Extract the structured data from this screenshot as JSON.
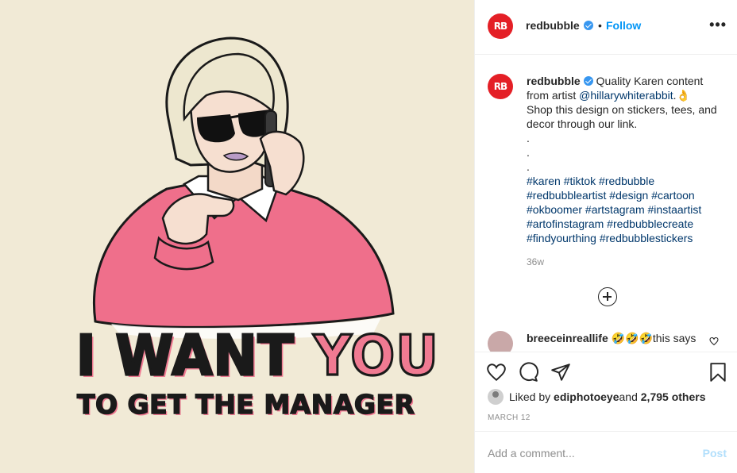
{
  "post_image": {
    "headline_part1": "I WANT",
    "headline_part2": "YOU",
    "subline": "TO GET THE MANAGER"
  },
  "header": {
    "avatar_text": "RB",
    "username": "redbubble",
    "separator": "•",
    "follow_label": "Follow",
    "more_label": "•••"
  },
  "caption": {
    "avatar_text": "RB",
    "username": "redbubble",
    "text_before_link": "Quality Karen content from artist ",
    "artist_link": "@hillarywhiterabbit",
    "text_after_link": ".👌 Shop this design on stickers, tees, and decor through our link.",
    "dots": [
      ".",
      ".",
      "."
    ],
    "hashtags": "#karen #tiktok #redbubble #redbubbleartist #design #cartoon #okboomer #artstagram #instaartist #artofinstagram #redbubblecreate #findyourthing #redbubblestickers",
    "timestamp": "36w"
  },
  "comment": {
    "username": "breeceinreallife",
    "text": "🤣🤣🤣this says"
  },
  "likes": {
    "prefix": "Liked by ",
    "user": "ediphotoeye",
    "middle": " and ",
    "others": "2,795 others"
  },
  "date": "MARCH 12",
  "add_comment": {
    "placeholder": "Add a comment...",
    "post_label": "Post"
  },
  "colors": {
    "brand_red": "#e41f26",
    "link_blue": "#00376b",
    "follow_blue": "#0095f6",
    "poster_pink": "#f07a92",
    "poster_bg": "#f1ead6"
  }
}
